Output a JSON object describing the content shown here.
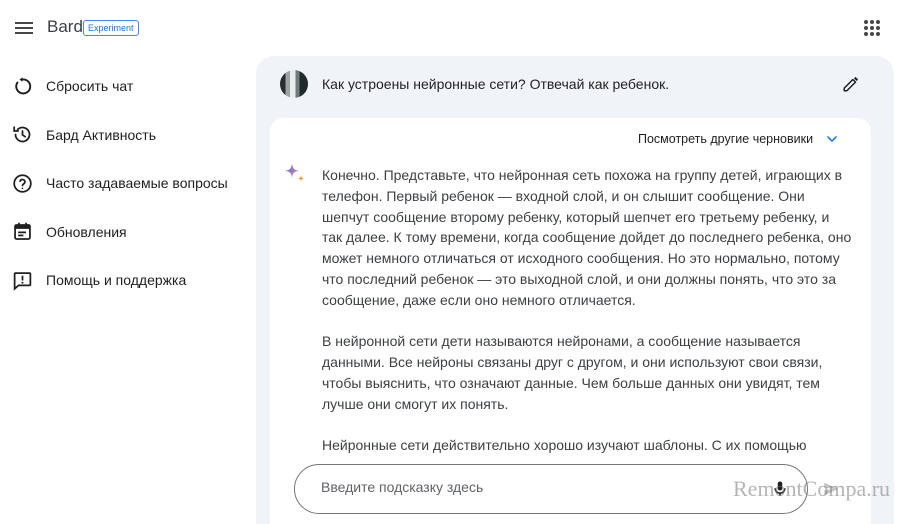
{
  "header": {
    "brand": "Bard",
    "badge": "Experiment",
    "menu_icon": "menu-icon",
    "apps_icon": "apps-grid-icon"
  },
  "sidebar": {
    "items": [
      {
        "label": "Сбросить чат",
        "icon": "reset-icon"
      },
      {
        "label": "Бард Активность",
        "icon": "history-icon"
      },
      {
        "label": "Часто задаваемые вопросы",
        "icon": "help-circle-icon"
      },
      {
        "label": "Обновления",
        "icon": "calendar-icon"
      },
      {
        "label": "Помощь и поддержка",
        "icon": "feedback-icon"
      }
    ]
  },
  "chat": {
    "prompt": "Как устроены нейронные сети? Отвечай как ребенок.",
    "drafts_label": "Посмотреть другие черновики",
    "paragraphs": [
      "Конечно. Представьте, что нейронная сеть похожа на группу детей, играющих в телефон. Первый ребенок — входной слой, и он слышит сообщение. Они шепчут сообщение второму ребенку, который шепчет его третьему ребенку, и так далее. К тому времени, когда сообщение дойдет до последнего ребенка, оно может немного отличаться от исходного сообщения. Но это нормально, потому что последний ребенок — это выходной слой, и они должны понять, что это за сообщение, даже если оно немного отличается.",
      "В нейронной сети дети называются нейронами, а сообщение называется данными. Все нейроны связаны друг с другом, и они используют свои связи, чтобы выяснить, что означают данные. Чем больше данных они увидят, тем лучше они смогут их понять.",
      "Нейронные сети действительно хорошо изучают шаблоны. С их помощью"
    ]
  },
  "input": {
    "placeholder": "Введите подсказку здесь",
    "value": ""
  },
  "watermark": "RemontCompa.ru",
  "colors": {
    "accent": "#1a73e8",
    "panel_bg": "#f0f4f9"
  }
}
